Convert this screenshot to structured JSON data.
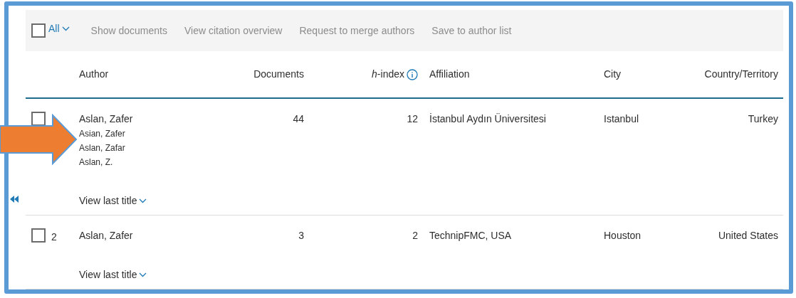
{
  "toolbar": {
    "select_all": {
      "label": "All",
      "checked": false
    },
    "actions": [
      "Show documents",
      "View citation overview",
      "Request to merge authors",
      "Save to author list"
    ]
  },
  "columns": [
    {
      "label": "Author",
      "kind": "text"
    },
    {
      "label": "Documents",
      "kind": "numeric"
    },
    {
      "label": "*h*-index",
      "kind": "numeric",
      "info": true
    },
    {
      "label": "Affiliation",
      "kind": "text"
    },
    {
      "label": "City",
      "kind": "text"
    },
    {
      "label": "Country/Territory",
      "kind": "numeric"
    }
  ],
  "rows": [
    {
      "checked": false,
      "author": "Aslan, Zafer",
      "name_variants": [
        "Asian, Zafer",
        "Aslan, Zafar",
        "Aslan, Z."
      ],
      "documents": "44",
      "h_index": "12",
      "affiliation": "İstanbul Aydın Üniversitesi",
      "city": "Istanbul",
      "country": "Turkey",
      "link": "View last title"
    },
    {
      "number": "2",
      "checked": false,
      "author": "Aslan, Zafer",
      "name_variants": [],
      "documents": "3",
      "h_index": "2",
      "affiliation": "TechnipFMC, USA",
      "city": "Houston",
      "country": "United States",
      "link": "View last title"
    }
  ]
}
